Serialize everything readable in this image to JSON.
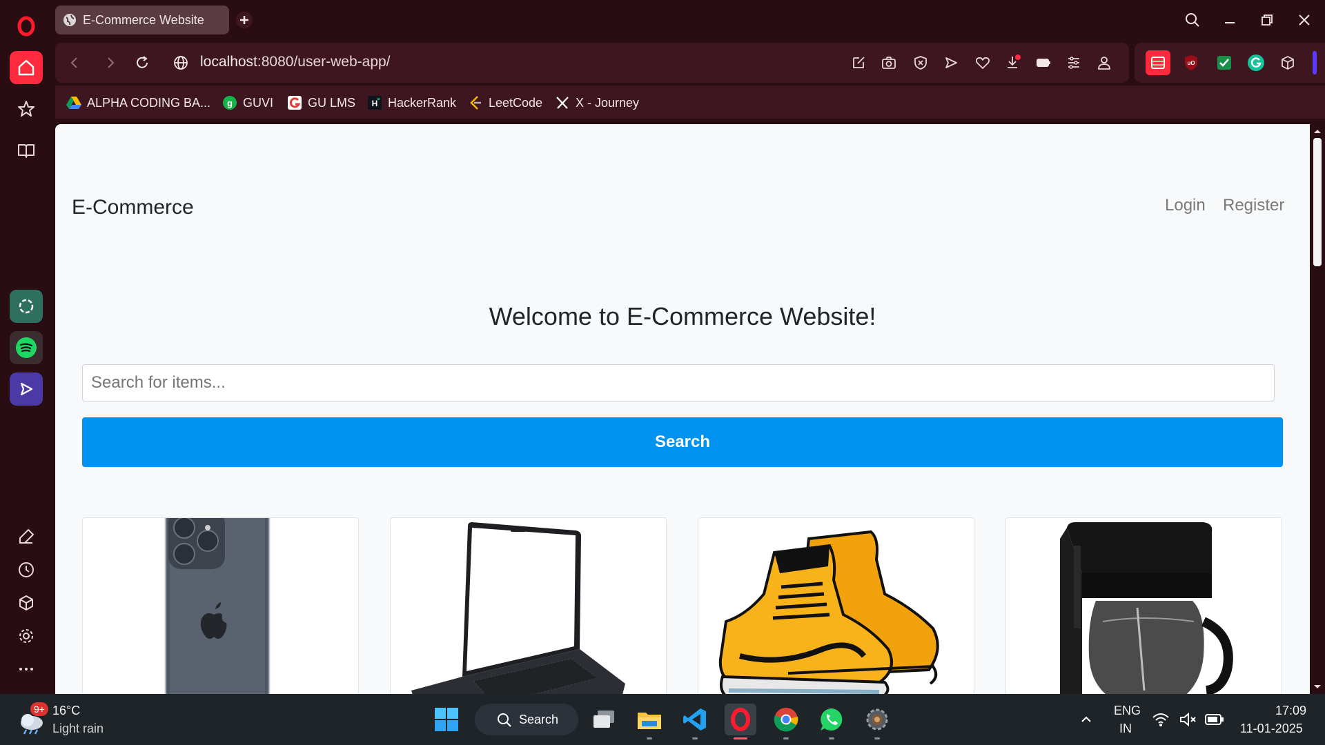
{
  "browser": {
    "tab_title": "E-Commerce Website",
    "url_host": "localhost",
    "url_path": ":8080/user-web-app/",
    "bookmarks": [
      {
        "label": "ALPHA CODING BA...",
        "icon": "google-drive-icon"
      },
      {
        "label": "GUVI",
        "icon": "guvi-icon"
      },
      {
        "label": "GU LMS",
        "icon": "gu-lms-icon"
      },
      {
        "label": "HackerRank",
        "icon": "hackerrank-icon"
      },
      {
        "label": "LeetCode",
        "icon": "leetcode-icon"
      },
      {
        "label": "X - Journey",
        "icon": "x-icon"
      }
    ]
  },
  "page": {
    "brand": "E-Commerce",
    "nav_login": "Login",
    "nav_register": "Register",
    "welcome": "Welcome to E-Commerce Website!",
    "search_placeholder": "Search for items...",
    "search_button": "Search",
    "products": [
      {
        "image": "smartphone"
      },
      {
        "image": "laptop"
      },
      {
        "image": "sneakers"
      },
      {
        "image": "coffee-maker"
      }
    ]
  },
  "taskbar": {
    "weather_temp": "16°C",
    "weather_desc": "Light rain",
    "weather_badge": "9+",
    "search_label": "Search",
    "lang_1": "ENG",
    "lang_2": "IN",
    "time": "17:09",
    "date": "11-01-2025"
  },
  "colors": {
    "browser_bg": "#2a0d12",
    "toolbar_bg": "#3e1620",
    "accent_red": "#ff1b2d",
    "search_button": "#0292f0"
  }
}
